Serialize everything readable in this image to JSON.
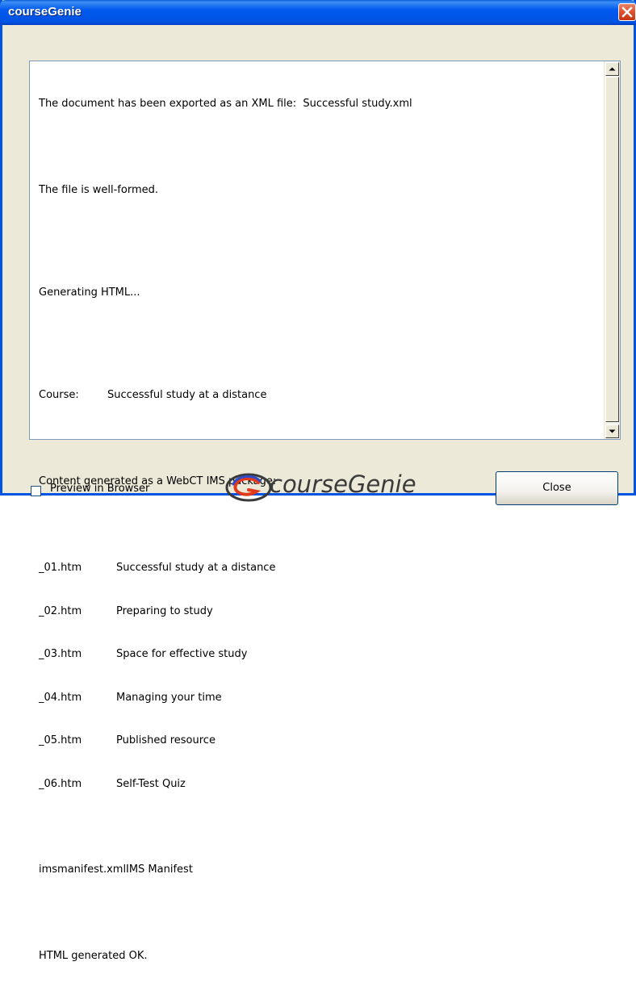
{
  "window": {
    "title": "courseGenie"
  },
  "log": {
    "line_exported": "The document has been exported as an XML file:  Successful study.xml",
    "line_wellformed": "The file is well-formed.",
    "line_generating": "Generating HTML...",
    "course_label": "Course:",
    "course_value": "Successful study at a distance",
    "line_package": "Content generated as a WebCT IMS package:",
    "files": [
      {
        "name": "_01.htm",
        "title": "Successful study at a distance"
      },
      {
        "name": "_02.htm",
        "title": "Preparing to study"
      },
      {
        "name": "_03.htm",
        "title": "Space for effective study"
      },
      {
        "name": "_04.htm",
        "title": "Managing your time"
      },
      {
        "name": "_05.htm",
        "title": "Published resource"
      },
      {
        "name": "_06.htm",
        "title": "Self-Test Quiz"
      }
    ],
    "manifest_name": "imsmanifest.xml",
    "manifest_title": "IMS Manifest",
    "line_ok": "HTML generated OK."
  },
  "footer": {
    "preview_label": "Preview in Browser",
    "preview_checked": false,
    "logo_text": "courseGenie",
    "close_label": "Close"
  }
}
